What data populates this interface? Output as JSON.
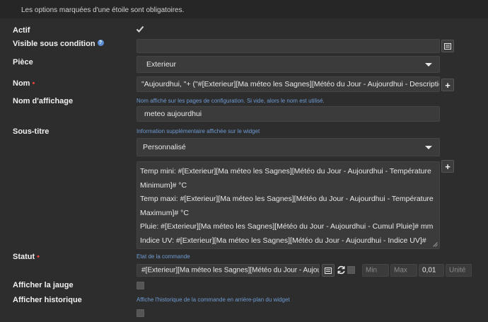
{
  "header": {
    "required_hint": "Les options marquées d'une étoile sont obligatoires."
  },
  "labels": {
    "actif": "Actif",
    "visible": "Visible sous condition",
    "piece": "Pièce",
    "nom": "Nom",
    "nom_affichage": "Nom d'affichage",
    "sous_titre": "Sous-titre",
    "statut": "Statut",
    "afficher_jauge": "Afficher la jauge",
    "afficher_historique": "Afficher historique"
  },
  "required_mark": "•",
  "help_mark": "?",
  "fields": {
    "actif_checked": true,
    "visible_value": "",
    "piece_value": "Exterieur",
    "nom_value": "\"Aujourdhui, \"+ (\"#[Exterieur][Ma méteo les Sagnes][Météo du Jour - Aujourdhui - Description]#\").to",
    "nom_affichage_help": "Nom affiché sur les pages de configuration. Si vide, alors le nom est utilisé.",
    "nom_affichage_value": "meteo aujourdhui",
    "sous_titre_help": "Information supplémentaire affichée sur le widget",
    "sous_titre_mode": "Personnalisé",
    "sous_titre_lines": [
      "Temp mini: #[Exterieur][Ma méteo les Sagnes][Météo du Jour - Aujourdhui - Température",
      "Minimum]# °C",
      "Temp maxi: #[Exterieur][Ma méteo les Sagnes][Météo du Jour - Aujourdhui - Température",
      "Maximum]# °C",
      "Pluie: #[Exterieur][Ma méteo les Sagnes][Météo du Jour - Aujourdhui - Cumul Pluie]# mm",
      "Indice UV: #[Exterieur][Ma méteo les Sagnes][Météo du Jour - Aujourdhui - Indice UV]#"
    ],
    "statut_help": "Etat de la commande",
    "statut_value": "#[Exterieur][Ma méteo les Sagnes][Météo du Jour - Aujourdhui -",
    "min_placeholder": "Min",
    "max_placeholder": "Max",
    "step_value": "0,01",
    "unit_placeholder": "Unité",
    "jauge_checked": false,
    "historique_help": "Affiche l'historique de la commande en arrière-plan du widget",
    "historique_checked": false
  },
  "icons": {
    "list": "list-icon",
    "plus": "plus-icon",
    "refresh": "refresh-icon",
    "caret": "chevron-down-icon",
    "check": "check-icon"
  },
  "colors": {
    "background": "#2d2d2d",
    "field": "#3b3b3b",
    "required": "#e0413a",
    "help_text": "#6f9bd2"
  }
}
